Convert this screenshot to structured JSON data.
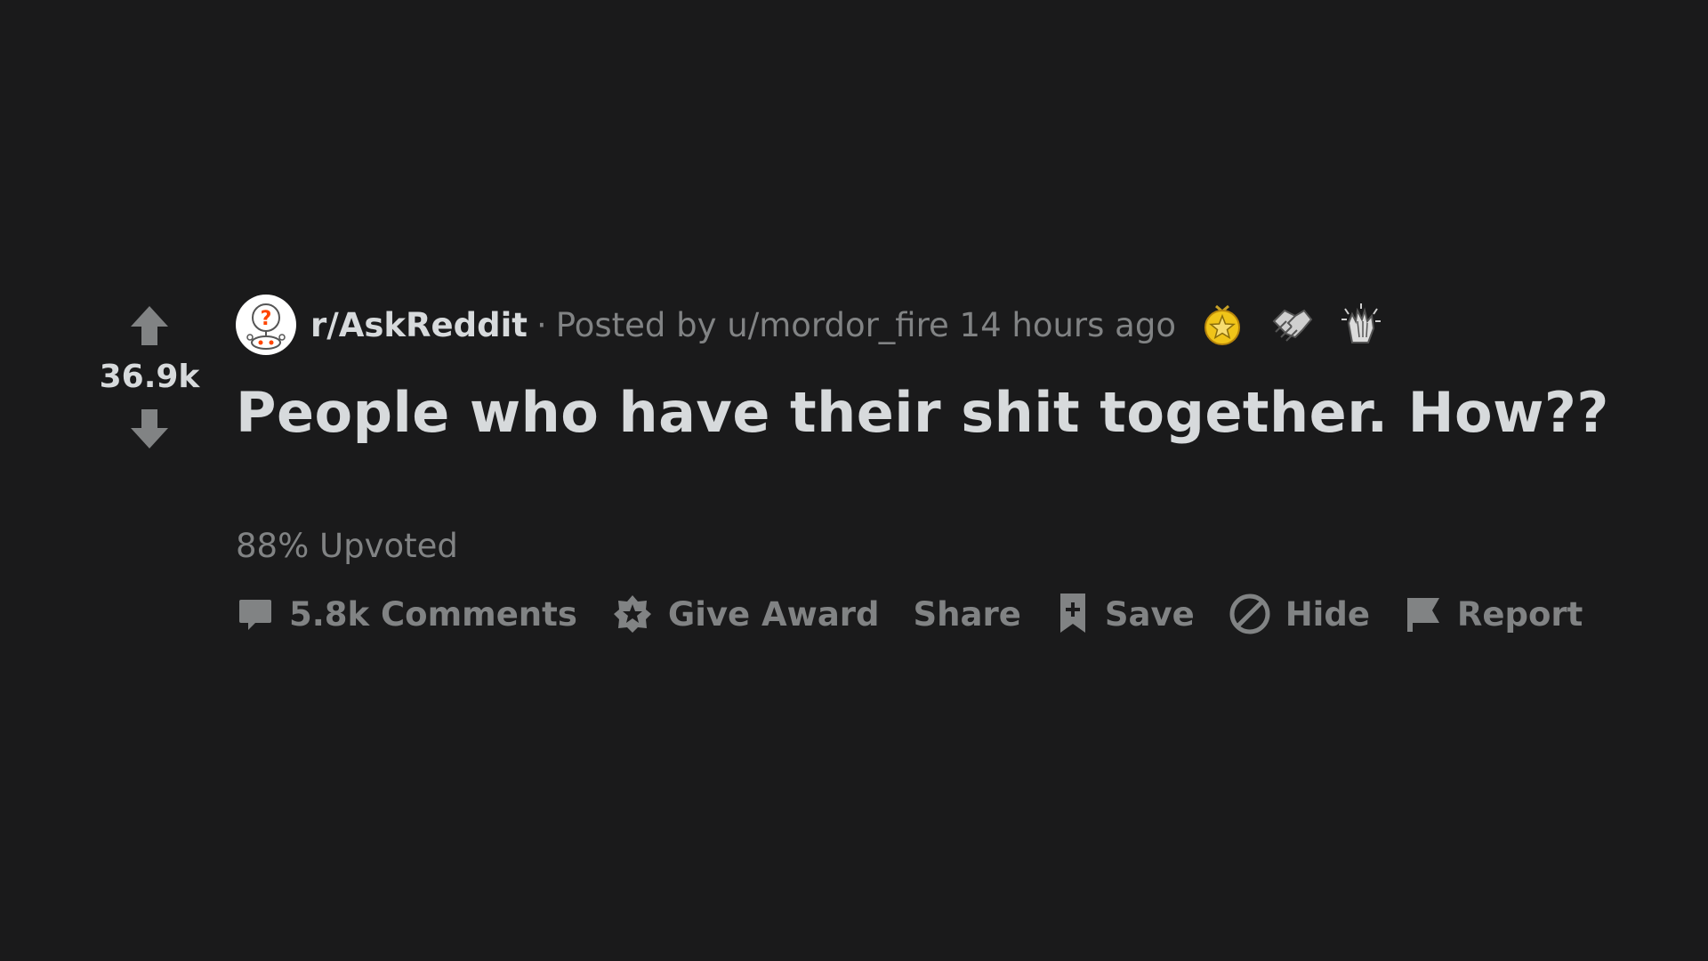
{
  "colors": {
    "background": "#1a1a1b",
    "text_primary": "#d7dadc",
    "text_secondary": "#818384",
    "icon": "#818384",
    "award_gold": "#f0c419"
  },
  "vote": {
    "score": "36.9k",
    "upvote_icon": "upvote-arrow-icon",
    "downvote_icon": "downvote-arrow-icon"
  },
  "meta": {
    "subreddit": "r/AskReddit",
    "separator": "·",
    "posted_by": "Posted by",
    "user": "u/mordor_fire",
    "time": "14 hours ago",
    "awards": [
      "gold-star-award-icon",
      "handshake-award-icon",
      "clapping-award-icon"
    ]
  },
  "post": {
    "title": "People who have their shit together. How??",
    "upvote_ratio": "88% Upvoted"
  },
  "actions": {
    "comments": "5.8k Comments",
    "give_award": "Give Award",
    "share": "Share",
    "save": "Save",
    "hide": "Hide",
    "report": "Report"
  }
}
